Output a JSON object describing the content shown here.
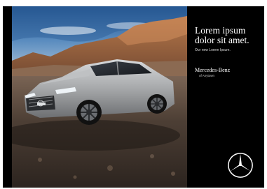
{
  "ad": {
    "headline": "Lorem ipsum dolor sit amet.",
    "subline": "Our new Lorem Ipsum.",
    "brand_name": "Mercedes-Benz",
    "brand_subline": "of Anytown",
    "logo_icon": "mercedes-star-icon"
  },
  "colors": {
    "panel_background": "#000000",
    "text_primary": "#ffffff",
    "car_body": "#a6a8aa"
  }
}
